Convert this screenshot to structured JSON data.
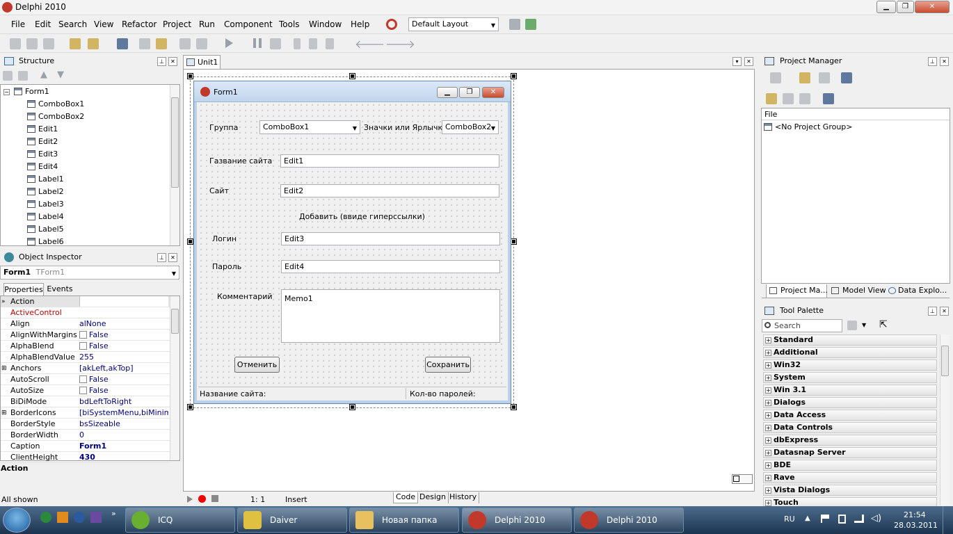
{
  "app": {
    "title": "Delphi 2010"
  },
  "menu": [
    "File",
    "Edit",
    "Search",
    "View",
    "Refactor",
    "Project",
    "Run",
    "Component",
    "Tools",
    "Window",
    "Help"
  ],
  "layout_select": "Default Layout",
  "structure": {
    "title": "Structure",
    "items": [
      "Form1",
      "ComboBox1",
      "ComboBox2",
      "Edit1",
      "Edit2",
      "Edit3",
      "Edit4",
      "Label1",
      "Label2",
      "Label3",
      "Label4",
      "Label5",
      "Label6"
    ]
  },
  "object_inspector": {
    "title": "Object Inspector",
    "selected_name": "Form1",
    "selected_type": "TForm1",
    "tab_properties": "Properties",
    "tab_events": "Events",
    "rows": [
      {
        "name": "Action",
        "value": ""
      },
      {
        "name": "ActiveControl",
        "value": ""
      },
      {
        "name": "Align",
        "value": "alNone"
      },
      {
        "name": "AlignWithMargins",
        "value": "False"
      },
      {
        "name": "AlphaBlend",
        "value": "False"
      },
      {
        "name": "AlphaBlendValue",
        "value": "255"
      },
      {
        "name": "Anchors",
        "value": "[akLeft,akTop]"
      },
      {
        "name": "AutoScroll",
        "value": "False"
      },
      {
        "name": "AutoSize",
        "value": "False"
      },
      {
        "name": "BiDiMode",
        "value": "bdLeftToRight"
      },
      {
        "name": "BorderIcons",
        "value": "[biSystemMenu,biMinimize,"
      },
      {
        "name": "BorderStyle",
        "value": "bsSizeable"
      },
      {
        "name": "BorderWidth",
        "value": "0"
      },
      {
        "name": "Caption",
        "value": "Form1"
      },
      {
        "name": "ClientHeight",
        "value": "430"
      }
    ],
    "desc": "Action",
    "status": "All shown"
  },
  "editor": {
    "tab": "Unit1",
    "status_pos": "1:   1",
    "status_mode": "Insert",
    "tabs": [
      "Code",
      "Design",
      "History"
    ]
  },
  "form": {
    "caption": "Form1",
    "lbl_group": "Группа",
    "combo1": "ComboBox1",
    "lbl_icons": "Значки или Ярлычки",
    "combo2": "ComboBox2",
    "lbl_site_name": "Газвание сайта",
    "edit1": "Edit1",
    "lbl_site": "Сайт",
    "edit2": "Edit2",
    "lbl_add": "Добавить (ввиде гиперссылки)",
    "lbl_login": "Логин",
    "edit3": "Edit3",
    "lbl_pass": "Пароль",
    "edit4": "Edit4",
    "lbl_comment": "Комментарий",
    "memo": "Memo1",
    "btn_cancel": "Отменить",
    "btn_save": "Сохранить",
    "status_left": "Название сайта:",
    "status_right": "Кол-во паролей:"
  },
  "project_manager": {
    "title": "Project Manager",
    "col_file": "File",
    "item": "<No Project Group>",
    "tabs": [
      "Project Ma...",
      "Model View",
      "Data Explo..."
    ]
  },
  "tool_palette": {
    "title": "Tool Palette",
    "search_placeholder": "Search",
    "categories": [
      "Standard",
      "Additional",
      "Win32",
      "System",
      "Win 3.1",
      "Dialogs",
      "Data Access",
      "Data Controls",
      "dbExpress",
      "Datasnap Server",
      "BDE",
      "Rave",
      "Vista Dialogs",
      "Touch"
    ]
  },
  "taskbar": {
    "tasks": [
      "ICQ",
      "Daiver",
      "Новая папка",
      "Delphi 2010",
      "Delphi 2010"
    ],
    "lang": "RU",
    "time": "21:54",
    "date": "28.03.2011"
  },
  "colors": {
    "accent": "#000080",
    "taskbar": "#1c3450"
  }
}
